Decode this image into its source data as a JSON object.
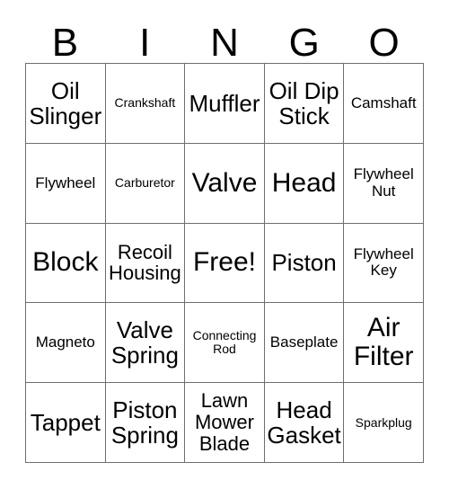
{
  "header": {
    "letters": [
      "B",
      "I",
      "N",
      "G",
      "O"
    ]
  },
  "grid": {
    "rows": [
      [
        {
          "label": "Oil\nSlinger",
          "size": "fs-lg"
        },
        {
          "label": "Crankshaft",
          "size": "fs-xs"
        },
        {
          "label": "Muffler",
          "size": "fs-lg"
        },
        {
          "label": "Oil Dip\nStick",
          "size": "fs-lg"
        },
        {
          "label": "Camshaft",
          "size": "fs-sm"
        }
      ],
      [
        {
          "label": "Flywheel",
          "size": "fs-sm"
        },
        {
          "label": "Carburetor",
          "size": "fs-xs"
        },
        {
          "label": "Valve",
          "size": "fs-xl"
        },
        {
          "label": "Head",
          "size": "fs-xl"
        },
        {
          "label": "Flywheel\nNut",
          "size": "fs-sm"
        }
      ],
      [
        {
          "label": "Block",
          "size": "fs-xl"
        },
        {
          "label": "Recoil\nHousing",
          "size": "fs-md"
        },
        {
          "label": "Free!",
          "size": "fs-xl"
        },
        {
          "label": "Piston",
          "size": "fs-lg"
        },
        {
          "label": "Flywheel\nKey",
          "size": "fs-sm"
        }
      ],
      [
        {
          "label": "Magneto",
          "size": "fs-sm"
        },
        {
          "label": "Valve\nSpring",
          "size": "fs-lg"
        },
        {
          "label": "Connecting\nRod",
          "size": "fs-xs"
        },
        {
          "label": "Baseplate",
          "size": "fs-sm"
        },
        {
          "label": "Air\nFilter",
          "size": "fs-xl"
        }
      ],
      [
        {
          "label": "Tappet",
          "size": "fs-lg"
        },
        {
          "label": "Piston\nSpring",
          "size": "fs-lg"
        },
        {
          "label": "Lawn\nMower\nBlade",
          "size": "fs-md"
        },
        {
          "label": "Head\nGasket",
          "size": "fs-lg"
        },
        {
          "label": "Sparkplug",
          "size": "fs-xs"
        }
      ]
    ]
  },
  "colors": {
    "border": "#6e6e6e",
    "text": "#000000",
    "background": "#ffffff"
  }
}
